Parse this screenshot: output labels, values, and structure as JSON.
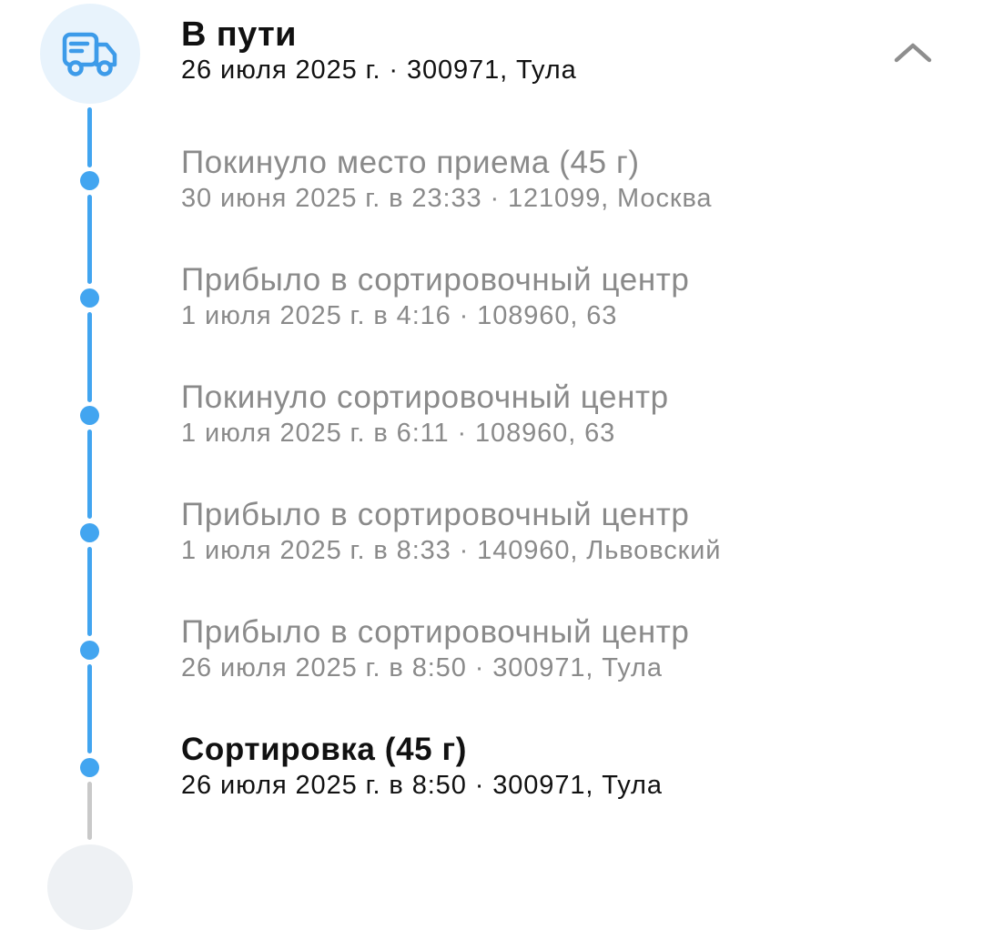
{
  "status": {
    "title": "В пути",
    "subtitle": "26 июля 2025 г. · 300971, Тула",
    "icon": "delivery-truck-icon",
    "collapse_icon": "chevron-up-icon"
  },
  "events": [
    {
      "title": "Покинуло место приема (45 г)",
      "subtitle": "30 июня 2025 г. в 23:33 · 121099, Москва"
    },
    {
      "title": "Прибыло в сортировочный центр",
      "subtitle": "1 июля 2025 г. в 4:16 · 108960, 63"
    },
    {
      "title": "Покинуло сортировочный центр",
      "subtitle": "1 июля 2025 г. в 6:11 · 108960, 63"
    },
    {
      "title": "Прибыло в сортировочный центр",
      "subtitle": "1 июля 2025 г. в 8:33 · 140960, Львовский"
    },
    {
      "title": "Прибыло в сортировочный центр",
      "subtitle": "26 июля 2025 г. в 8:50 · 300971, Тула"
    },
    {
      "title": "Сортировка (45 г)",
      "subtitle": "26 июля 2025 г. в 8:50 · 300971, Тула"
    }
  ],
  "colors": {
    "accent": "#42a5f0",
    "icon_bg": "#e8f3fc",
    "muted_text": "#8a8a8a",
    "primary_text": "#111111",
    "inactive_line": "#c9c9c9"
  }
}
